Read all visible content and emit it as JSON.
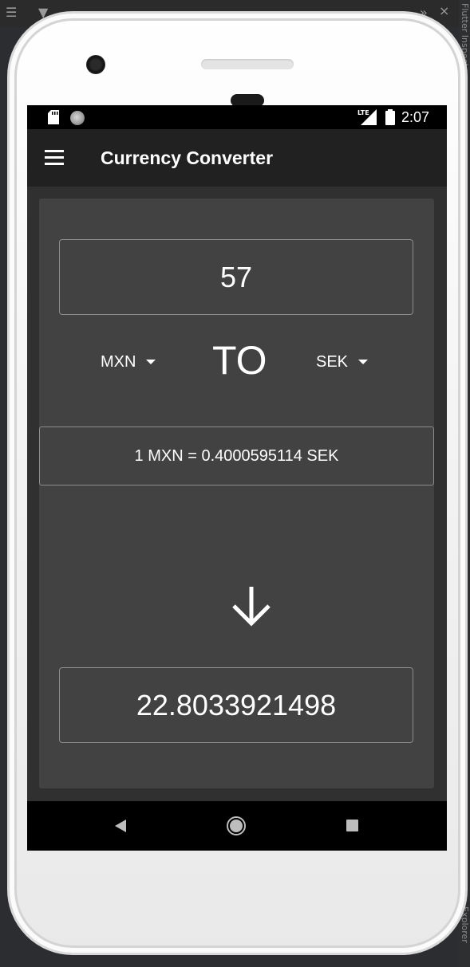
{
  "status_bar": {
    "time": "2:07",
    "network_label": "LTE",
    "icons": [
      "sd-card-icon",
      "sync-icon",
      "lte-signal-icon",
      "battery-icon"
    ]
  },
  "app_bar": {
    "title": "Currency Converter",
    "menu_icon": "menu-icon"
  },
  "converter": {
    "amount": "57",
    "from_currency": "MXN",
    "to_label": "TO",
    "to_currency": "SEK",
    "rate_text": "1 MXN = 0.4000595114 SEK",
    "result": "22.8033921498"
  },
  "nav_bar": {
    "icons": [
      "back-icon",
      "home-icon",
      "recents-icon"
    ]
  },
  "ide_side_labels": {
    "top": "Flutter Inspector",
    "bottom": "Explorer"
  },
  "colors": {
    "app_bar": "#212121",
    "background": "#303030",
    "card": "#424242",
    "border": "#8c8c8c",
    "text": "#ffffff"
  }
}
